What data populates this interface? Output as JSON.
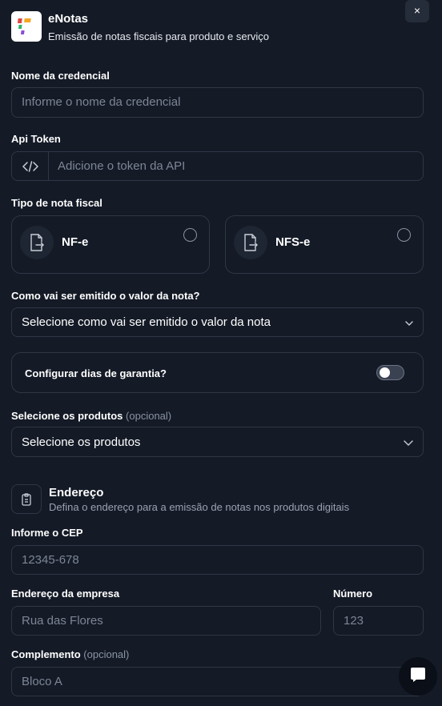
{
  "app": {
    "title": "eNotas",
    "subtitle": "Emissão de notas fiscais para produto e serviço",
    "close_label": "×"
  },
  "credential": {
    "label": "Nome da credencial",
    "placeholder": "Informe o nome da credencial"
  },
  "api_token": {
    "label": "Api Token",
    "placeholder": "Adicione o token da API",
    "icon": "code-icon"
  },
  "invoice_type": {
    "label": "Tipo de nota fiscal",
    "options": [
      {
        "label": "NF-e",
        "icon": "file-export-icon"
      },
      {
        "label": "NFS-e",
        "icon": "file-export-icon"
      }
    ]
  },
  "emission": {
    "label": "Como vai ser emitido o valor da nota?",
    "placeholder": "Selecione como vai ser emitido o valor da nota"
  },
  "warranty": {
    "label": "Configurar dias de garantia?",
    "enabled": false
  },
  "products": {
    "label": "Selecione os produtos",
    "optional": "(opcional)",
    "placeholder": "Selecione os produtos"
  },
  "address": {
    "title": "Endereço",
    "subtitle": "Defina o endereço para a emissão de notas nos produtos digitais",
    "icon": "clipboard-icon"
  },
  "cep": {
    "label": "Informe o CEP",
    "placeholder": "12345-678"
  },
  "company_address": {
    "label": "Endereço da empresa",
    "placeholder": "Rua das Flores"
  },
  "number": {
    "label": "Número",
    "placeholder": "123"
  },
  "complement": {
    "label": "Complemento",
    "optional": "(opcional)",
    "placeholder": "Bloco A"
  },
  "colors": {
    "background": "#141a26",
    "border": "#2f3746",
    "text": "#ffffff",
    "muted": "#7d8696"
  }
}
